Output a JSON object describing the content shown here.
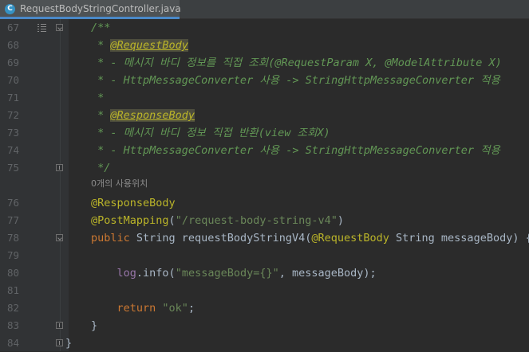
{
  "tab": {
    "icon_letter": "C",
    "title": "RequestBodyStringController.java"
  },
  "inlay_hint": "0개의 사용위치",
  "lines": [
    {
      "num": "67",
      "parts": [
        {
          "t": "/**",
          "c": "doc"
        }
      ]
    },
    {
      "num": "68",
      "parts": [
        {
          "t": " * ",
          "c": "doc"
        },
        {
          "t": "@RequestBody",
          "c": "tag"
        }
      ]
    },
    {
      "num": "69",
      "parts": [
        {
          "t": " * - 메시지 바디 정보를 직접 조회(@RequestParam X, @ModelAttribute X)",
          "c": "doc"
        }
      ]
    },
    {
      "num": "70",
      "parts": [
        {
          "t": " * - HttpMessageConverter 사용 -> StringHttpMessageConverter 적용",
          "c": "doc"
        }
      ]
    },
    {
      "num": "71",
      "parts": [
        {
          "t": " *",
          "c": "doc"
        }
      ]
    },
    {
      "num": "72",
      "parts": [
        {
          "t": " * ",
          "c": "doc"
        },
        {
          "t": "@ResponseBody",
          "c": "tag"
        }
      ]
    },
    {
      "num": "73",
      "parts": [
        {
          "t": " * - 메시지 바디 정보 직접 반환(view 조회X)",
          "c": "doc"
        }
      ]
    },
    {
      "num": "74",
      "parts": [
        {
          "t": " * - HttpMessageConverter 사용 -> StringHttpMessageConverter 적용",
          "c": "doc"
        }
      ]
    },
    {
      "num": "75",
      "parts": [
        {
          "t": " */",
          "c": "doc"
        }
      ]
    },
    {
      "num": "76",
      "parts": [
        {
          "t": "@ResponseBody",
          "c": "ann"
        }
      ]
    },
    {
      "num": "77",
      "parts": [
        {
          "t": "@PostMapping",
          "c": "ann"
        },
        {
          "t": "(",
          "c": "fn"
        },
        {
          "t": "\"/request-body-string-v4\"",
          "c": "str"
        },
        {
          "t": ")",
          "c": "fn"
        }
      ]
    },
    {
      "num": "78",
      "parts": [
        {
          "t": "public ",
          "c": "kw"
        },
        {
          "t": "String requestBodyStringV4(",
          "c": "fn"
        },
        {
          "t": "@RequestBody ",
          "c": "ann"
        },
        {
          "t": "String messageBody) {",
          "c": "fn"
        }
      ]
    },
    {
      "num": "79",
      "parts": []
    },
    {
      "num": "80",
      "parts": [
        {
          "t": "    ",
          "c": "fn"
        },
        {
          "t": "log",
          "c": "field"
        },
        {
          "t": ".info(",
          "c": "fn"
        },
        {
          "t": "\"messageBody={}\"",
          "c": "str"
        },
        {
          "t": ", messageBody);",
          "c": "fn"
        }
      ]
    },
    {
      "num": "81",
      "parts": []
    },
    {
      "num": "82",
      "parts": [
        {
          "t": "    ",
          "c": "fn"
        },
        {
          "t": "return ",
          "c": "kw"
        },
        {
          "t": "\"ok\"",
          "c": "str"
        },
        {
          "t": ";",
          "c": "fn"
        }
      ]
    },
    {
      "num": "83",
      "parts": [
        {
          "t": "}",
          "c": "fn"
        }
      ]
    },
    {
      "num": "84",
      "parts": [
        {
          "t": "}",
          "c": "fn"
        }
      ]
    }
  ]
}
